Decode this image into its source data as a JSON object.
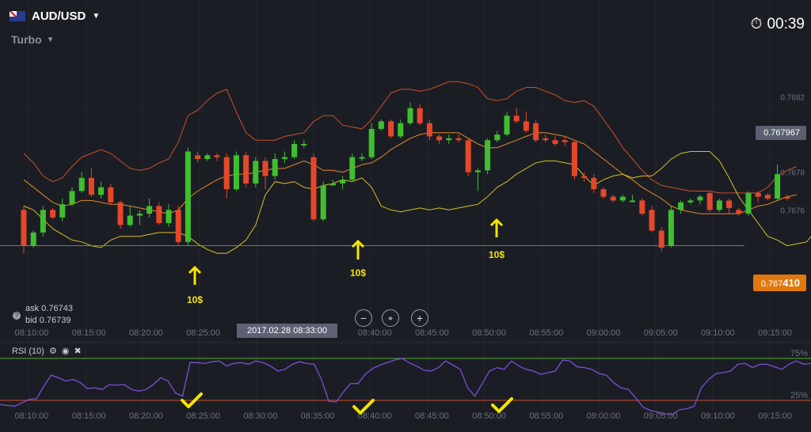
{
  "header": {
    "asset": "AUD/USD",
    "mode": "Turbo",
    "timer": "00:39"
  },
  "prices": {
    "current": "0.767967",
    "strike_main": "0.767",
    "strike_bold": "410"
  },
  "quote": {
    "ask": "ask 0.76743",
    "bid": "bid 0.76739"
  },
  "crosshair": {
    "date": "2017.02.28 08:33:00"
  },
  "rsi": {
    "label": "RSI (10)",
    "upper_label": "75%",
    "lower_label": "25%"
  },
  "trades": [
    {
      "amount": "10$"
    },
    {
      "amount": "10$"
    },
    {
      "amount": "10$"
    }
  ],
  "colors": {
    "up": "#3fbf2f",
    "down": "#e5472b",
    "band_upper": "#c8502a",
    "band_middle": "#e08a28",
    "band_lower": "#d8c020",
    "rsi_line": "#7b4fd6",
    "rsi_upper": "#4caf2f",
    "rsi_lower": "#d24a2a",
    "arrow": "#f5e400"
  },
  "chart_data": {
    "type": "candlestick",
    "x_ticks": [
      "08:10:00",
      "08:15:00",
      "08:20:00",
      "08:25:00",
      "08:30:00",
      "08:35:00",
      "08:40:00",
      "08:45:00",
      "08:50:00",
      "08:55:00",
      "09:00:00",
      "09:05:00",
      "09:10:00",
      "09:15:00"
    ],
    "y_ticks": [
      "0.7682",
      "0.768",
      "0.7678",
      "0.7676"
    ],
    "ylim": [
      0.76732,
      0.76842
    ],
    "candles": [
      [
        0.7676,
        0.76741,
        0.76762,
        0.76737
      ],
      [
        0.76741,
        0.76748,
        0.76749,
        0.7674
      ],
      [
        0.76748,
        0.7676,
        0.76762,
        0.76746
      ],
      [
        0.7676,
        0.76756,
        0.76761,
        0.76755
      ],
      [
        0.76756,
        0.76763,
        0.76766,
        0.76754
      ],
      [
        0.76763,
        0.7677,
        0.76772,
        0.76762
      ],
      [
        0.7677,
        0.76777,
        0.7678,
        0.76769
      ],
      [
        0.76777,
        0.76768,
        0.76782,
        0.76767
      ],
      [
        0.76768,
        0.76772,
        0.76775,
        0.76766
      ],
      [
        0.76772,
        0.76764,
        0.76774,
        0.76763
      ],
      [
        0.76764,
        0.76752,
        0.76765,
        0.7675
      ],
      [
        0.76752,
        0.76757,
        0.76762,
        0.76751
      ],
      [
        0.76757,
        0.76758,
        0.7676,
        0.76752
      ],
      [
        0.76758,
        0.76762,
        0.76766,
        0.76756
      ],
      [
        0.76762,
        0.76753,
        0.76764,
        0.76752
      ],
      [
        0.76753,
        0.7676,
        0.76763,
        0.76751
      ],
      [
        0.7676,
        0.76743,
        0.76762,
        0.76741
      ],
      [
        0.76743,
        0.76791,
        0.76793,
        0.76741
      ],
      [
        0.76789,
        0.76787,
        0.76791,
        0.76785
      ],
      [
        0.76787,
        0.76789,
        0.7679,
        0.76786
      ],
      [
        0.76789,
        0.76788,
        0.7679,
        0.76786
      ],
      [
        0.76788,
        0.76771,
        0.7679,
        0.76766
      ],
      [
        0.76771,
        0.76789,
        0.76791,
        0.7677
      ],
      [
        0.76789,
        0.76774,
        0.76791,
        0.76772
      ],
      [
        0.76774,
        0.76786,
        0.76788,
        0.76772
      ],
      [
        0.76786,
        0.76778,
        0.76788,
        0.76771
      ],
      [
        0.76778,
        0.76787,
        0.7679,
        0.76776
      ],
      [
        0.76787,
        0.76788,
        0.76791,
        0.76785
      ],
      [
        0.76788,
        0.76795,
        0.76797,
        0.76787
      ],
      [
        0.76795,
        0.76795,
        0.76797,
        0.76793
      ],
      [
        0.76788,
        0.76755,
        0.7679,
        0.76754
      ],
      [
        0.76755,
        0.76773,
        0.76775,
        0.76754
      ],
      [
        0.76773,
        0.76774,
        0.76776,
        0.76773
      ],
      [
        0.76774,
        0.76776,
        0.76778,
        0.76771
      ],
      [
        0.76776,
        0.76788,
        0.7679,
        0.76775
      ],
      [
        0.76788,
        0.76788,
        0.7679,
        0.76786
      ],
      [
        0.76788,
        0.76803,
        0.76806,
        0.76787
      ],
      [
        0.76803,
        0.76807,
        0.76808,
        0.76802
      ],
      [
        0.76807,
        0.76799,
        0.76808,
        0.76798
      ],
      [
        0.76799,
        0.76806,
        0.76808,
        0.76798
      ],
      [
        0.76806,
        0.76814,
        0.76817,
        0.76805
      ],
      [
        0.76814,
        0.76806,
        0.76816,
        0.76805
      ],
      [
        0.76806,
        0.76799,
        0.76808,
        0.76797
      ],
      [
        0.76799,
        0.76797,
        0.768,
        0.76795
      ],
      [
        0.76797,
        0.76798,
        0.768,
        0.76795
      ],
      [
        0.76798,
        0.76797,
        0.768,
        0.76796
      ],
      [
        0.76797,
        0.7678,
        0.76798,
        0.76778
      ],
      [
        0.7678,
        0.76781,
        0.76782,
        0.7677
      ],
      [
        0.76781,
        0.76797,
        0.76798,
        0.76779
      ],
      [
        0.76797,
        0.768,
        0.76802,
        0.76796
      ],
      [
        0.768,
        0.7681,
        0.76812,
        0.76799
      ],
      [
        0.7681,
        0.76807,
        0.76814,
        0.76806
      ],
      [
        0.76807,
        0.76802,
        0.76812,
        0.76801
      ],
      [
        0.76806,
        0.76797,
        0.76808,
        0.76796
      ],
      [
        0.76798,
        0.76797,
        0.768,
        0.76796
      ],
      [
        0.76797,
        0.76795,
        0.76799,
        0.76794
      ],
      [
        0.76797,
        0.76796,
        0.76799,
        0.76794
      ],
      [
        0.76796,
        0.76778,
        0.76797,
        0.76776
      ],
      [
        0.76778,
        0.76777,
        0.7678,
        0.76775
      ],
      [
        0.76777,
        0.76771,
        0.76779,
        0.76769
      ],
      [
        0.76771,
        0.76767,
        0.76772,
        0.76766
      ],
      [
        0.76767,
        0.76765,
        0.76768,
        0.76764
      ],
      [
        0.76765,
        0.76767,
        0.76768,
        0.76764
      ],
      [
        0.76765,
        0.76765,
        0.76768,
        0.76764
      ],
      [
        0.76765,
        0.76758,
        0.76766,
        0.76757
      ],
      [
        0.7676,
        0.76749,
        0.76762,
        0.76748
      ],
      [
        0.76749,
        0.7674,
        0.76751,
        0.76738
      ],
      [
        0.76741,
        0.7676,
        0.76762,
        0.7674
      ],
      [
        0.7676,
        0.76764,
        0.76765,
        0.76758
      ],
      [
        0.76764,
        0.76765,
        0.76766,
        0.76763
      ],
      [
        0.76765,
        0.76767,
        0.76768,
        0.76763
      ],
      [
        0.76769,
        0.7676,
        0.7677,
        0.76759
      ],
      [
        0.7676,
        0.76765,
        0.76766,
        0.76759
      ],
      [
        0.76765,
        0.76761,
        0.76766,
        0.76758
      ],
      [
        0.7676,
        0.76758,
        0.76761,
        0.76757
      ],
      [
        0.76758,
        0.76769,
        0.7677,
        0.76757
      ],
      [
        0.76769,
        0.76767,
        0.7677,
        0.76764
      ],
      [
        0.76768,
        0.76766,
        0.76769,
        0.76765
      ],
      [
        0.76766,
        0.76779,
        0.76784,
        0.76765
      ],
      [
        0.76767,
        0.76766,
        0.76768,
        0.76765
      ]
    ],
    "bollinger_upper": [
      0.7679,
      0.76785,
      0.76778,
      0.76775,
      0.76777,
      0.76783,
      0.76788,
      0.7679,
      0.76792,
      0.7679,
      0.76786,
      0.76782,
      0.76781,
      0.76782,
      0.76785,
      0.76787,
      0.76796,
      0.7681,
      0.76813,
      0.76818,
      0.76822,
      0.76824,
      0.76812,
      0.76801,
      0.76797,
      0.76797,
      0.76797,
      0.76799,
      0.768,
      0.76801,
      0.76807,
      0.7681,
      0.7681,
      0.76805,
      0.76804,
      0.76803,
      0.76808,
      0.76815,
      0.76822,
      0.76824,
      0.76824,
      0.76823,
      0.76824,
      0.76826,
      0.76828,
      0.76828,
      0.76827,
      0.76825,
      0.76819,
      0.76818,
      0.76819,
      0.76823,
      0.76825,
      0.76825,
      0.76823,
      0.76821,
      0.76818,
      0.76817,
      0.76818,
      0.76815,
      0.76808,
      0.76801,
      0.76793,
      0.76787,
      0.76781,
      0.76776,
      0.76773,
      0.76772,
      0.76771,
      0.7677,
      0.7677,
      0.7677,
      0.76769,
      0.76769,
      0.76769,
      0.76769,
      0.76769,
      0.76772,
      0.76778,
      0.76781,
      0.76783
    ],
    "bollinger_middle": [
      0.76776,
      0.76772,
      0.76768,
      0.76764,
      0.76762,
      0.76763,
      0.76765,
      0.76765,
      0.76764,
      0.76763,
      0.76763,
      0.76762,
      0.76761,
      0.7676,
      0.76759,
      0.76758,
      0.7676,
      0.76766,
      0.7677,
      0.76773,
      0.76776,
      0.76778,
      0.76779,
      0.76779,
      0.7678,
      0.76781,
      0.76782,
      0.76782,
      0.76784,
      0.76786,
      0.76784,
      0.76781,
      0.76781,
      0.7678,
      0.76782,
      0.76784,
      0.76785,
      0.76788,
      0.76792,
      0.76795,
      0.76798,
      0.768,
      0.76801,
      0.76801,
      0.76801,
      0.76801,
      0.76798,
      0.76795,
      0.76793,
      0.76793,
      0.76795,
      0.76797,
      0.76799,
      0.76801,
      0.76801,
      0.768,
      0.76799,
      0.76797,
      0.76795,
      0.76791,
      0.76787,
      0.76783,
      0.76779,
      0.76776,
      0.76772,
      0.76769,
      0.76766,
      0.76762,
      0.7676,
      0.76759,
      0.76758,
      0.76758,
      0.76758,
      0.76758,
      0.76758,
      0.7676,
      0.76762,
      0.76763,
      0.76765,
      0.76767,
      0.76768
    ],
    "bollinger_lower": [
      0.76762,
      0.7676,
      0.76755,
      0.7675,
      0.76747,
      0.76744,
      0.76743,
      0.76741,
      0.7674,
      0.76744,
      0.76746,
      0.76746,
      0.76746,
      0.76747,
      0.76748,
      0.76748,
      0.76748,
      0.76746,
      0.76742,
      0.76739,
      0.76737,
      0.76737,
      0.7674,
      0.76744,
      0.76752,
      0.76768,
      0.76775,
      0.76774,
      0.76775,
      0.76772,
      0.76771,
      0.76773,
      0.76774,
      0.76776,
      0.76775,
      0.76777,
      0.76772,
      0.76762,
      0.7676,
      0.76759,
      0.7676,
      0.76761,
      0.7676,
      0.76761,
      0.7676,
      0.76761,
      0.76762,
      0.76763,
      0.76767,
      0.76772,
      0.76775,
      0.76779,
      0.76782,
      0.76785,
      0.76786,
      0.76786,
      0.76785,
      0.76784,
      0.76778,
      0.76773,
      0.76776,
      0.76778,
      0.76779,
      0.76777,
      0.76778,
      0.76778,
      0.76782,
      0.76787,
      0.7679,
      0.76791,
      0.76791,
      0.76791,
      0.76786,
      0.76777,
      0.76767,
      0.7676,
      0.76753,
      0.76746,
      0.76744,
      0.76741,
      0.76742,
      0.76743,
      0.76749,
      0.76756,
      0.76756,
      0.76755,
      0.76754,
      0.76752,
      0.7675
    ],
    "rsi": {
      "period": 10,
      "upper": 75,
      "lower": 25,
      "values": [
        20,
        19,
        18,
        22,
        26,
        27,
        42,
        55,
        52,
        48,
        50,
        46,
        39,
        40,
        38,
        44,
        43,
        44,
        38,
        36,
        38,
        44,
        52,
        48,
        34,
        30,
        70,
        70,
        69,
        71,
        72,
        66,
        69,
        70,
        68,
        72,
        70,
        66,
        60,
        62,
        68,
        71,
        69,
        68,
        50,
        24,
        23,
        35,
        45,
        45,
        56,
        63,
        67,
        70,
        73,
        75,
        70,
        66,
        61,
        60,
        64,
        72,
        67,
        62,
        40,
        30,
        45,
        60,
        64,
        62,
        72,
        66,
        62,
        60,
        56,
        58,
        60,
        73,
        72,
        65,
        64,
        62,
        57,
        55,
        46,
        40,
        38,
        28,
        17,
        13,
        11,
        9,
        8,
        14,
        15,
        18,
        40,
        50,
        57,
        58,
        60,
        68,
        69,
        64,
        68,
        68,
        65,
        62,
        68,
        72,
        68,
        69
      ]
    },
    "trade_markers": [
      {
        "time": "08:25:00",
        "amount": "10$"
      },
      {
        "time": "08:40:00",
        "amount": "10$"
      },
      {
        "time": "08:50:00",
        "amount": "10$"
      }
    ],
    "strike_price": 0.76741,
    "current_price": 0.767967
  }
}
